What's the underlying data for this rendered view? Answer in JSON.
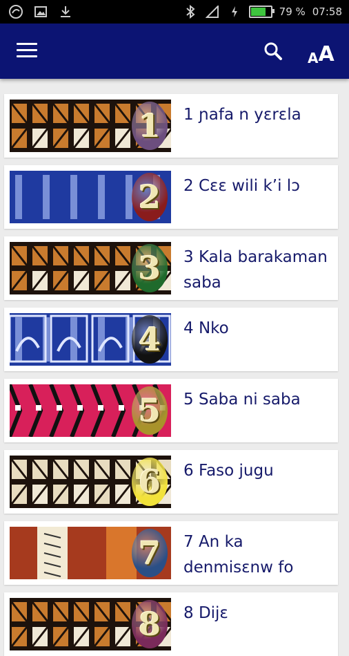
{
  "status_bar": {
    "battery": "79 %",
    "time": "07:58"
  },
  "app_bar": {
    "font_label_small": "A",
    "font_label_big": "A"
  },
  "items": [
    {
      "title": "1 ɲafa n yɛrɛla",
      "number": "1",
      "badge_color": "#6c4e7e",
      "pattern": "mud"
    },
    {
      "title": "2 Cɛɛ wili k’i lɔ",
      "number": "2",
      "badge_color": "#8a1c1c",
      "pattern": "indigo"
    },
    {
      "title": "3 Kala barakaman saba",
      "number": "3",
      "badge_color": "#1f6a2c",
      "pattern": "mud2"
    },
    {
      "title": "4 Nko",
      "number": "4",
      "badge_color": "#111111",
      "pattern": "indigo2"
    },
    {
      "title": "5 Saba ni saba",
      "number": "5",
      "badge_color": "#a8932a",
      "pattern": "pink"
    },
    {
      "title": "6 Faso jugu",
      "number": "6",
      "badge_color": "#f2e23a",
      "pattern": "mud3"
    },
    {
      "title": "7 An ka denmisɛnw fo",
      "number": "7",
      "badge_color": "#2a4f86",
      "pattern": "red"
    },
    {
      "title": "8 Dijɛ",
      "number": "8",
      "badge_color": "#7a2a5a",
      "pattern": "mud"
    }
  ]
}
